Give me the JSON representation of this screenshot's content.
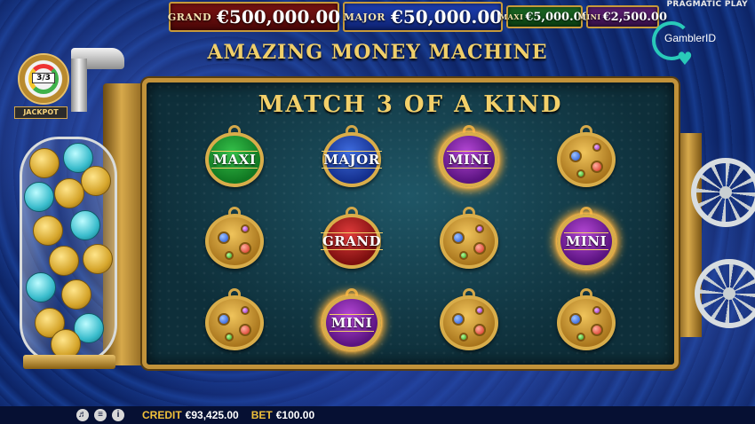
{
  "jackpots": {
    "grand": {
      "label": "GRAND",
      "value": "€500,000.00"
    },
    "major": {
      "label": "MAJOR",
      "value": "€50,000.00"
    },
    "maxi": {
      "label": "MAXI",
      "value": "€5,000.00"
    },
    "mini": {
      "label": "MINI",
      "value": "€2,500.00"
    }
  },
  "provider": "PRAGMATIC PLAY",
  "brand_logo": {
    "text": "GamblerID",
    "icon": "heart-icon"
  },
  "game_title": "AMAZING MONEY MACHINE",
  "machine": {
    "counter": "3/3",
    "label": "JACKPOT"
  },
  "board": {
    "title": "MATCH 3 OF A KIND",
    "rows": [
      [
        {
          "type": "maxi",
          "label": "MAXI"
        },
        {
          "type": "major",
          "label": "MAJOR"
        },
        {
          "type": "mini",
          "label": "MINI",
          "glow": true
        },
        {
          "type": "gear",
          "label": ""
        }
      ],
      [
        {
          "type": "gear",
          "label": ""
        },
        {
          "type": "grand",
          "label": "GRAND"
        },
        {
          "type": "gear",
          "label": ""
        },
        {
          "type": "mini",
          "label": "MINI",
          "glow": true
        }
      ],
      [
        {
          "type": "gear",
          "label": ""
        },
        {
          "type": "mini",
          "label": "MINI",
          "glow": true
        },
        {
          "type": "gear",
          "label": ""
        },
        {
          "type": "gear",
          "label": ""
        }
      ]
    ]
  },
  "status_bar": {
    "credit_label": "CREDIT",
    "credit_value": "€93,425.00",
    "bet_label": "BET",
    "bet_value": "€100.00",
    "icons": [
      "speaker-icon",
      "menu-icon",
      "info-icon"
    ]
  },
  "colors": {
    "gold": "#f3d06a",
    "grand": "#7a1212",
    "major": "#1d3fb4",
    "maxi": "#1c6a24",
    "mini": "#5e1f74",
    "background": "#0c1f5e"
  }
}
